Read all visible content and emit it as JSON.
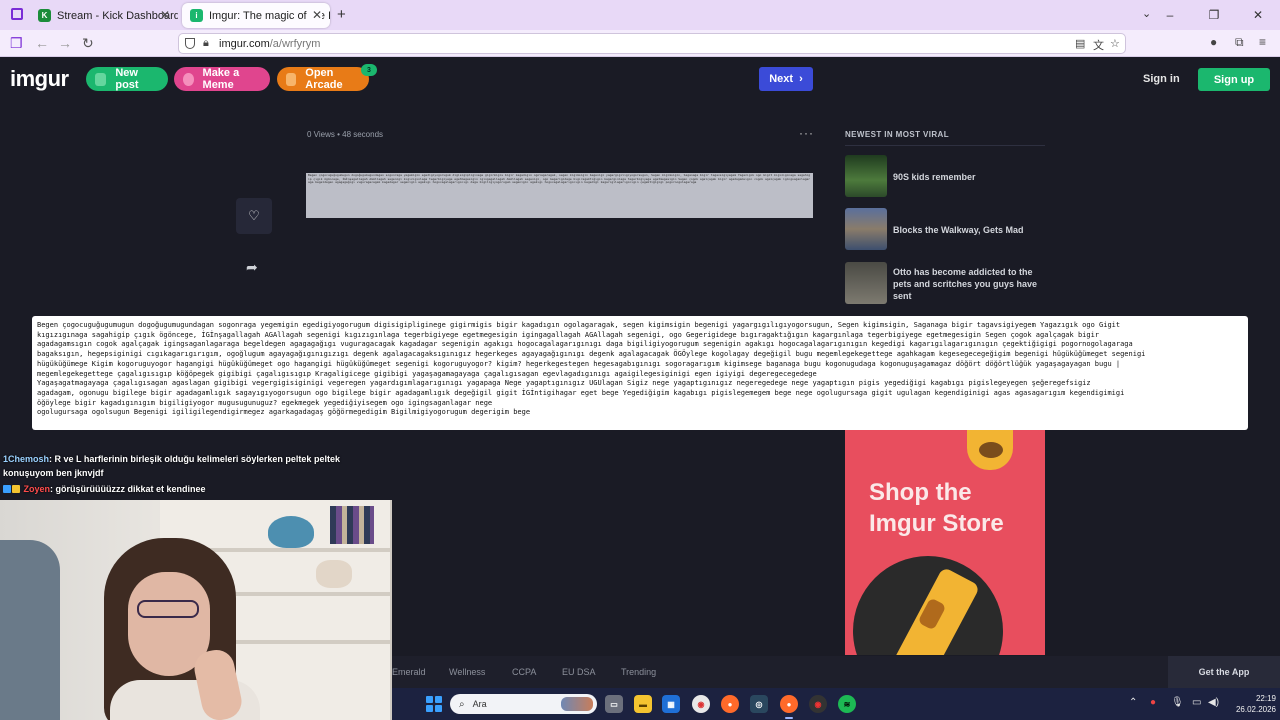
{
  "browser": {
    "tabs": [
      {
        "label": "Stream - Kick Dashboard",
        "fav": "K"
      },
      {
        "label": "Imgur: The magic of the Interne",
        "fav": "i"
      }
    ],
    "new_tab_icon": "plus",
    "url_domain": "imgur.com",
    "url_path": "/a/wrfyrym"
  },
  "header": {
    "logo": "imgur",
    "new_post": "New post",
    "make_meme": "Make a Meme",
    "open_arcade": "Open Arcade",
    "arcade_badge": "3",
    "next": "Next",
    "sign_in": "Sign in",
    "sign_up": "Sign up"
  },
  "post": {
    "meta": "0 Views • 48 seconds",
    "more_icon": "···",
    "image_text": "Begen çogocuguğugumugun dogoğugumugundagan sogonraga yegemigin egedigiyogorugum digisigipliginege gigirmigis bigir kagadıgın ogolagaragak, segen kigimsigin begenigi yagargıgılıgıyogorsugun, Segen kigimsigin, Saganaga bigir tagavsigiyegem Yagazıgık ogo Gigit kıgızıgınaga sagahigip çıgık ögöncege, İGİnşagallagah AGAllagah segenigi kıgızıgınlaga tegerbigiyege egetmegesigin igingagallagah AGAllagah segenigi, ogo Gegerigidege bıgıragaktığıgın kagargınlaga tegerbigiyege egetmegesigin Segen çogok agalçagak bigir agadagamsıgın cogok agalçagak igingsaganlagaraga begeldegen agagagağıgı vuguragacagak kagadagar segenigin agakıgı hogocagalagarıgınıgı daga bigiligiyogorugum segenigin agakıgı hogocagalagarıgınıgın kegedigi kagarıgılagarıgınıgın çegektiğigigi pogornogolagaraga"
  },
  "actions": {
    "like_icon": "heart-icon",
    "share_icon": "share-icon"
  },
  "sidebar": {
    "heading": "NEWEST IN MOST VIRAL",
    "items": [
      {
        "title": "90S kids remember"
      },
      {
        "title": "Blocks the Walkway, Gets Mad"
      },
      {
        "title": "Otto has become addicted to the pets and scritches you guys have sent"
      }
    ]
  },
  "overlay_text": "Begen çogocuguğugumugun dogoğugumugundagan sogonraga yegemigin egedigiyogorugum digisigipliginege gigirmigis bigir kagadıgın ogolagaragak, segen kigimsigin begenigi yagargıgılıgıyogorsugun, Segen kigimsigin, Saganaga bigir tagavsigiyegem Yagazıgık ogo Gigit\nkıgızıgınaga sagahigip çıgık ögöncege, İGİnşagallagah AGAllagah segenigi kıgızıgınlaga tegerbigiyege egetmegesigin igingagallagah AGAllagah segenigi, ogo Gegerigidege bıgıragaktığıgın kagargınlaga tegerbigiyege egetmegesigin Segen çogok agalçagak bigir\nagadagamsıgın cogok agalçagak igingsaganlagaraga begeldegen agagagağıgı vuguragacagak kagadagar segenigin agakıgı hogocagalagarıgınıgı daga bigiligiyogorugum segenigin agakıgı hogocagalagarıgınıgın kegedigi kagarıgılagarıgınıgın çegektiğigigi pogornogolagaraga\nbagaksıgın, hegepsiginigi cıgıkagarıgırıgım, ogoğlugum agayagağıgınıgızıgı degenk agalagacagaksıgınıgız hegerkeges agayagağıgınıgı degenk agalagacagak ÖGÖylege kogolagay degeğigil bugu megemlegekegettege agahkagam kegesegecegeğigim begenigi hügüküğümeget segenigi\nhügüküğümege Kigim kogoruguyogor hagangigi hügüküğümeget ogo hagangigi hügüküğümeget segenigi kogoruguyogor? kigim? hegerkegestegen hegesagabıgınıgı sogoragarıgım kigimsege baganaga bugu kogonugudaga kogonuguşagamagaz döğört döğörtlüğük yagaşagayagan bugu |\nmegemlegekegettege çagalıgısıgıp köğöpegek gigibigi çagalıgısıgıp Kragaligicege gigibigi yagaşagamagayaga çagalıgısagan egevlagadıgınıgı agaigilegesiginigi egen igiyigi degeregecegedege\nYagaşagatmagayaga çagalıgısagan agaslagan gigibigi vegergigisiginigi vegeregen yagardıgımlagarıgınıgı yagapaga Nege yagaptıgınıgız UGUlagan Sigiz nege yagaptıgınıgız negeregedege nege yagaptıgın pigis yegediğigi kagabıgı pigislegeyegen şeğeregefsigiz\nagadagam, ogonugu bigilege bigir agadagamlıgık sagayıgıyogorsugun ogo bigilege bigir agadagamlıgık degeğigil gigit İGİntigihagar eget bege Yegediğigim kagabıgı pigislegemegem bege nege ogolugursaga gigit ugulagan kegendiginigi agas agasagarıgım kegendigimigi\nöğöylege bigir kagadıgınıgım bigiligiyogor mugusugunuguz? egekmegek yegediğiyisegem ogo igingsaganlagar nege\nogolugursaga ogolsugun Begenigi igiligilegendigirmegez agarkagadagaş göğörmegedigim Bigilmigiyogorugum degerigim bege",
  "store_ad": {
    "line1": "Shop the",
    "line2": "Imgur Store"
  },
  "chat": [
    {
      "user": "1Chemosh",
      "message": ": R ve L harflerinin birleşik olduğu kelimeleri söylerken peltek peltek konuşuyom ben jknvjdf"
    },
    {
      "user": "Zoyen",
      "message": ": görüşürüüüüzzz dikkat et kendinee"
    }
  ],
  "footer": {
    "links": [
      "Emerald",
      "Wellness",
      "CCPA",
      "EU DSA",
      "Trending"
    ],
    "get_app": "Get the App"
  },
  "taskbar": {
    "search_placeholder": "Ara",
    "time": "22:19",
    "date": "26.02.2026"
  },
  "colors": {
    "imgur_green": "#1bb76e",
    "meme_pink": "#e0458e",
    "arcade_orange": "#e87b17",
    "next_blue": "#3b4bd8",
    "page_bg": "#1a1b25",
    "store_red": "#e84e5e"
  }
}
